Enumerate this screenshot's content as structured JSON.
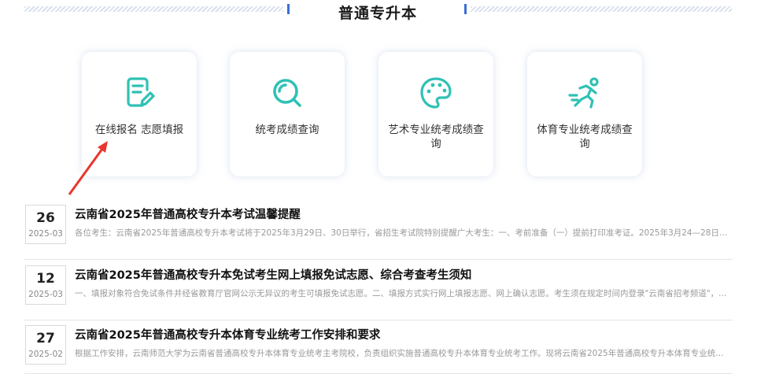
{
  "section": {
    "title": "普通专升本"
  },
  "cards": [
    {
      "label": "在线报名 志愿填报",
      "icon": "edit-document-icon"
    },
    {
      "label": "统考成绩查询",
      "icon": "search-icon"
    },
    {
      "label": "艺术专业统考成绩查询",
      "icon": "palette-icon"
    },
    {
      "label": "体育专业统考成绩查询",
      "icon": "running-person-icon"
    }
  ],
  "news": [
    {
      "day": "26",
      "ym": "2025-03",
      "title": "云南省2025年普通高校专升本考试温馨提醒",
      "summary": "各位考生：云南省2025年普通高校专升本考试将于2025年3月29日、30日举行，省招生考试院特别提醒广大考生：一、考前准备（一）提前打印准考证。2025年3月24—28日，考..."
    },
    {
      "day": "12",
      "ym": "2025-03",
      "title": "云南省2025年普通高校专升本免试考生网上填报免试志愿、综合考查考生须知",
      "summary": "一、填报对象符合免试条件并经省教育厅官网公示无异议的考生可填报免试志愿。二、填报方式实行网上填报志愿、网上确认志愿。考生须在规定时间内登录\"云南省招考频道\"，..."
    },
    {
      "day": "27",
      "ym": "2025-02",
      "title": "云南省2025年普通高校专升本体育专业统考工作安排和要求",
      "summary": "根据工作安排，云南师范大学为云南省普通高校专升本体育专业统考主考院校，负责组织实施普通高校专升本体育专业统考工作。现将云南省2025年普通高校专升本体育专业统考..."
    }
  ],
  "colors": {
    "accent": "#2fc1b5",
    "title_tick": "#3b6fd4",
    "arrow": "#e8362d"
  }
}
